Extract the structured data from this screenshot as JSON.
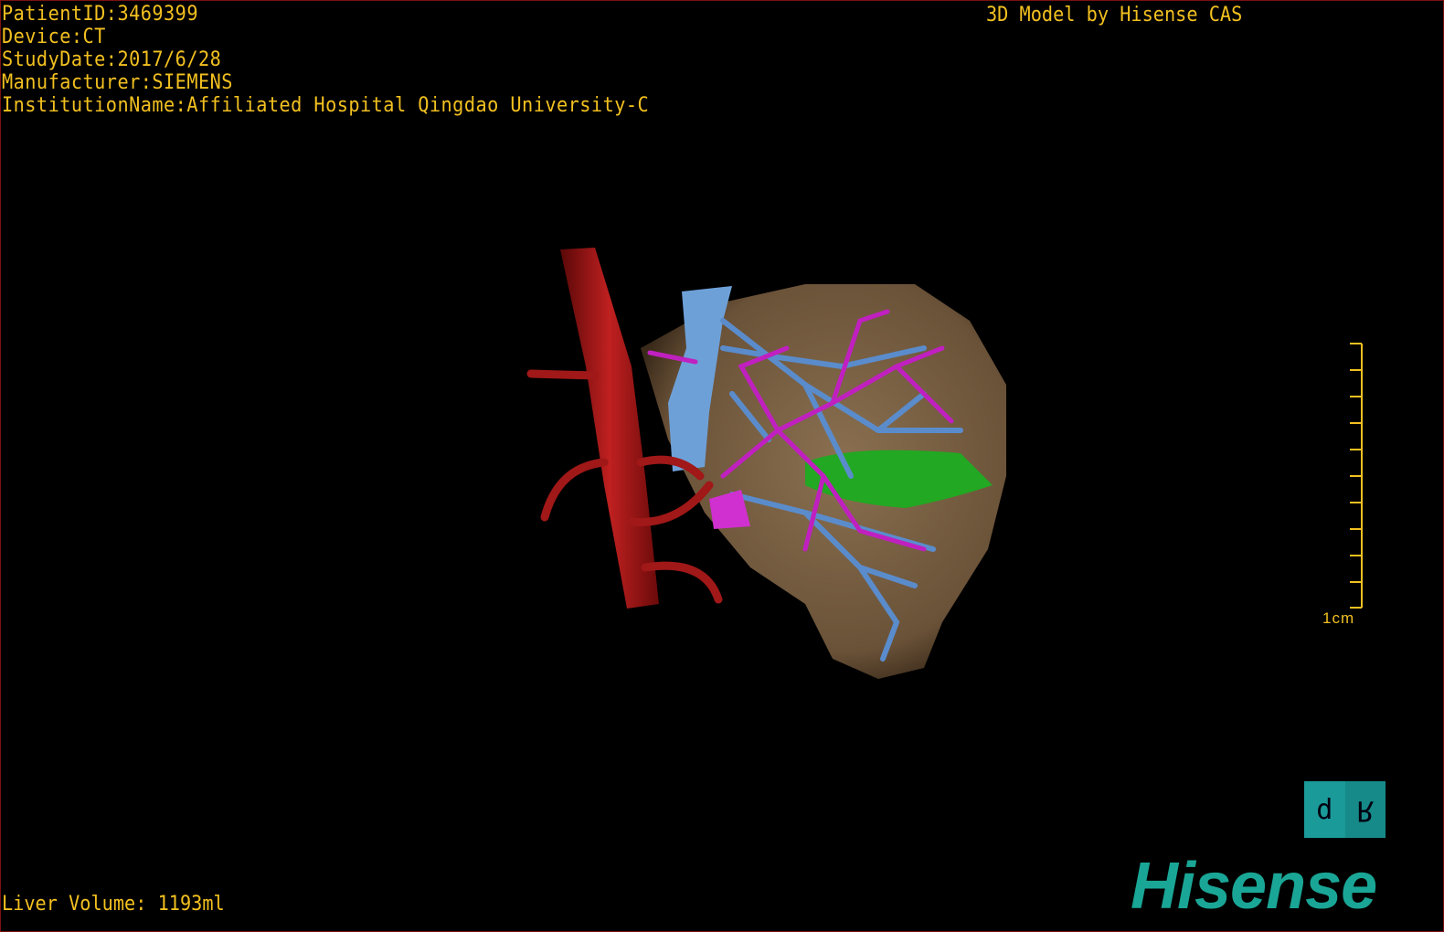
{
  "overlay": {
    "patient_id": "PatientID:3469399",
    "device": "Device:CT",
    "study_date": "StudyDate:2017/6/28",
    "manufacturer": "Manufacturer:SIEMENS",
    "institution": "InstitutionName:Affiliated Hospital Qingdao University-C",
    "credit": "3D Model by Hisense CAS",
    "liver_volume": "Liver Volume: 1193ml"
  },
  "scale_bar": {
    "label": "1cm"
  },
  "orientation_cube": {
    "left_face": "d",
    "right_face": "R"
  },
  "brand": {
    "logo_text": "Hisense"
  },
  "colors": {
    "overlay_text": "#f2c020",
    "liver": "#7a6448",
    "aorta": "#a01818",
    "portal_vein": "#5a8ccc",
    "hepatic_artery": "#c020c0",
    "gallbladder": "#20a020",
    "brand": "#1aa696"
  }
}
